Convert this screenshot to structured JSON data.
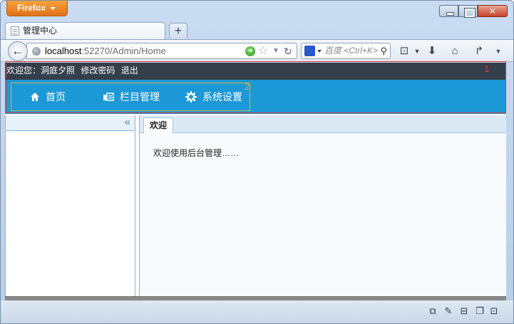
{
  "browser": {
    "app_button_label": "Firefox",
    "close_glyph": "✕",
    "tab_title": "管理中心",
    "new_tab_glyph": "+",
    "url_host": "localhost",
    "url_rest": ":52270/Admin/Home",
    "search_placeholder": "百度 <Ctrl+K>",
    "search_engine_icon": "paw-icon",
    "toolbar_icons": [
      "addon-icon",
      "download-icon",
      "home-icon",
      "share-icon",
      "menu-icon"
    ]
  },
  "page": {
    "topbar": {
      "greeting": "欢迎您：洞庭夕照",
      "change_password": "修改密码",
      "logout": "退出"
    },
    "annotations": {
      "mark_1": "1",
      "mark_2": "2"
    },
    "menu": [
      {
        "label": "首页",
        "icon": "home-icon"
      },
      {
        "label": "栏目管理",
        "icon": "columns-icon"
      },
      {
        "label": "系统设置",
        "icon": "gear-icon"
      }
    ],
    "west_panel": {
      "collapse_glyph": "«"
    },
    "center_panel": {
      "tab_label": "欢迎",
      "welcome_text": "欢迎使用后台管理……"
    }
  },
  "statusbar_icons": [
    "addon-bar-icon",
    "brush-icon",
    "mask-icon",
    "window-icon",
    "camera-icon"
  ],
  "colors": {
    "topbar_bg": "#343f4b",
    "menubar_bg": "#1d98d6",
    "annotation_red": "#e0363a",
    "annotation_gold": "#c9b54a",
    "firefox_orange": "#e2711b"
  }
}
